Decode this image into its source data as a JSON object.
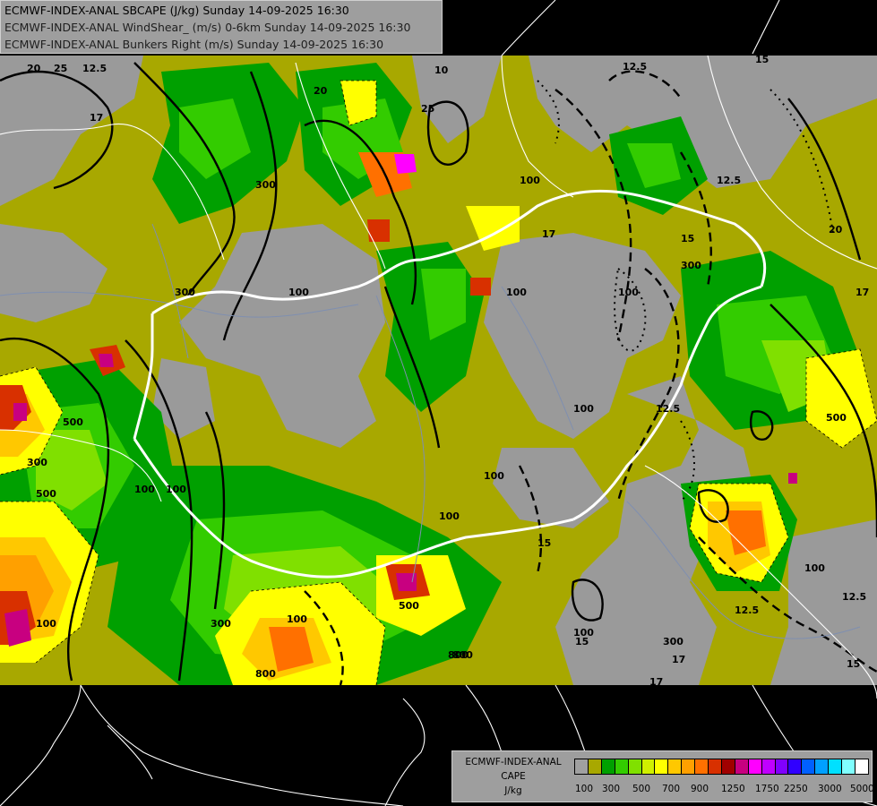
{
  "titles": [
    {
      "text": "ECMWF-INDEX-ANAL SBCAPE (J/kg) Sunday 14-09-2025 16:30",
      "color": "#000000"
    },
    {
      "text": "ECMWF-INDEX-ANAL WindShear_ (m/s) 0-6km Sunday 14-09-2025 16:30",
      "color": "#202020"
    },
    {
      "text": "ECMWF-INDEX-ANAL Bunkers Right (m/s) Sunday 14-09-2025 16:30",
      "color": "#202020"
    }
  ],
  "legend": {
    "title_lines": [
      "ECMWF-INDEX-ANAL",
      "CAPE",
      "J/kg"
    ],
    "colors": [
      "#a0a0a0",
      "#a8a800",
      "#00a000",
      "#33cc00",
      "#80e000",
      "#d0f000",
      "#ffff00",
      "#ffc800",
      "#ffa000",
      "#ff7000",
      "#d83000",
      "#a00000",
      "#c80080",
      "#ff00ff",
      "#c000ff",
      "#8000ff",
      "#3000ff",
      "#0060ff",
      "#00a0ff",
      "#00e0ff",
      "#80ffff",
      "#ffffff"
    ],
    "ticks": [
      "100",
      "300",
      "500",
      "700",
      "900",
      "1250",
      "1750",
      "2250",
      "3000",
      "5000"
    ]
  },
  "map_labels": [
    "25",
    "20",
    "12.5",
    "15",
    "10",
    "17",
    "25",
    "20",
    "15",
    "12.5",
    "20",
    "17",
    "12.5",
    "100",
    "300",
    "500",
    "100",
    "300",
    "500",
    "800",
    "800",
    "300",
    "100",
    "100",
    "12.5",
    "15",
    "17",
    "100",
    "12.5",
    "500",
    "300",
    "100",
    "12.5",
    "15",
    "17",
    "100",
    "300",
    "17",
    "100",
    "300",
    "100",
    "15",
    "100",
    "100",
    "500",
    "100",
    "100",
    "800"
  ]
}
